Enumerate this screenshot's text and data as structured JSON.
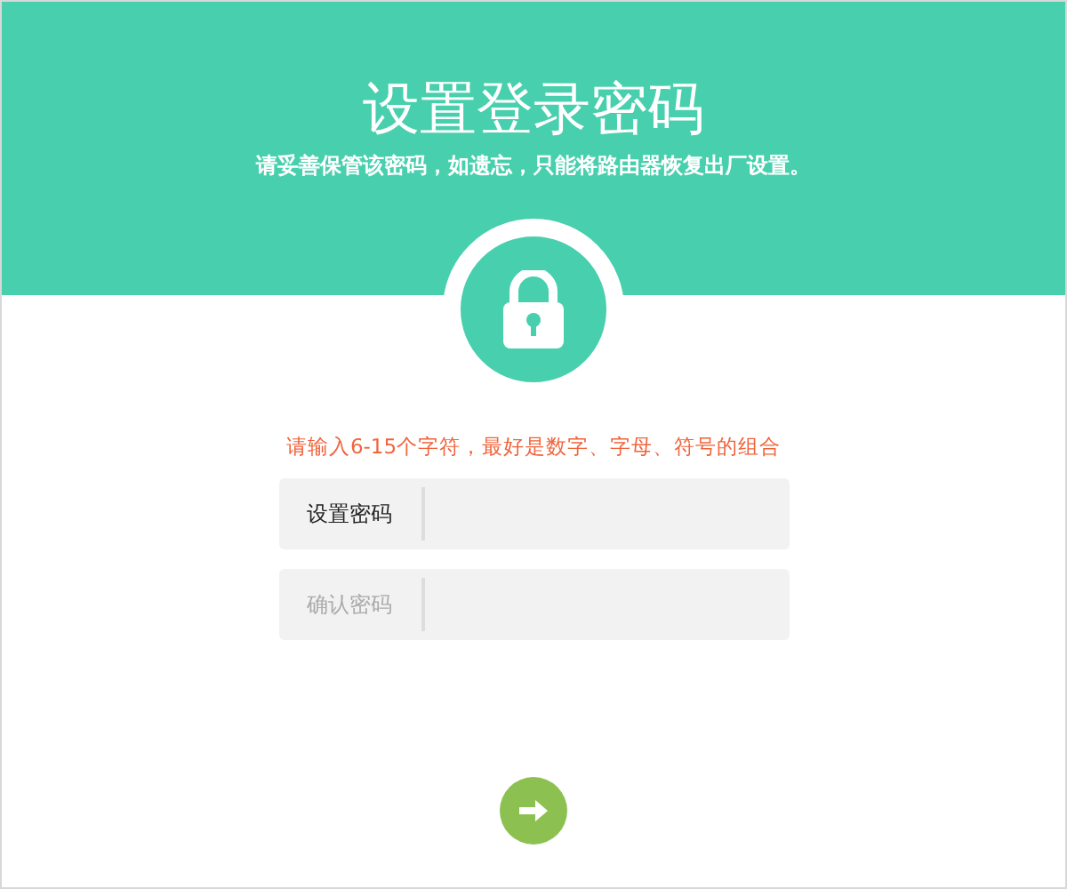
{
  "header": {
    "title": "设置登录密码",
    "subtitle": "请妥善保管该密码，如遗忘，只能将路由器恢复出厂设置。"
  },
  "hint": "请输入6-15个字符，最好是数字、字母、符号的组合",
  "fields": [
    {
      "label": "设置密码",
      "active": true
    },
    {
      "label": "确认密码",
      "active": false
    }
  ]
}
